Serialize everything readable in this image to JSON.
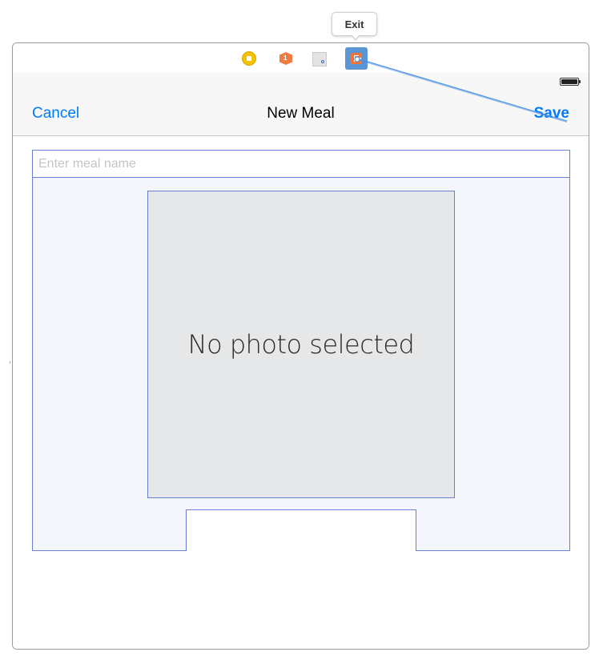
{
  "tooltip": {
    "label": "Exit"
  },
  "scene_dock": {
    "icons": [
      "view-controller-icon",
      "first-responder-icon",
      "gesture-icon",
      "exit-icon"
    ],
    "responder_badge": "1"
  },
  "nav": {
    "cancel_label": "Cancel",
    "title": "New Meal",
    "save_label": "Save"
  },
  "form": {
    "name_placeholder": "Enter meal name",
    "photo_placeholder": "No photo selected"
  },
  "colors": {
    "ios_tint": "#007aff",
    "selection_outline": "#6b7fd4",
    "connection_line": "#4a90e2"
  }
}
